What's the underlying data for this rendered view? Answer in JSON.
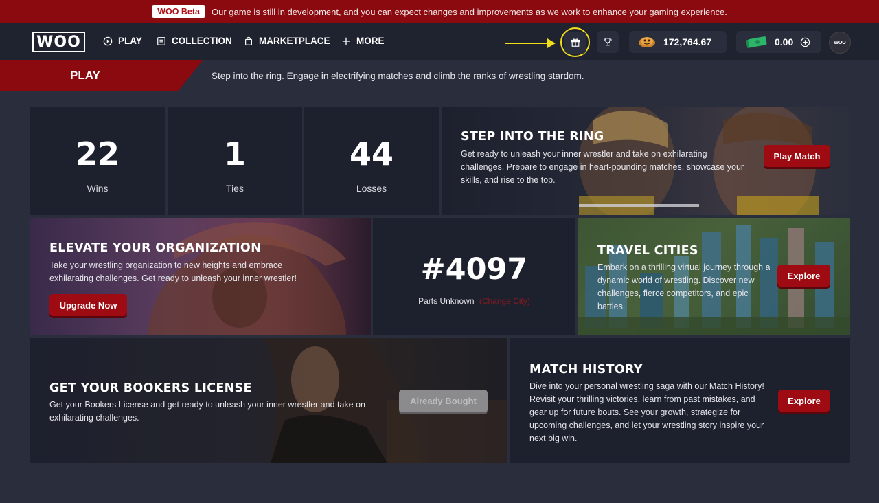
{
  "banner": {
    "badge": "WOO Beta",
    "message": "Our game is still in development, and you can expect changes and improvements as we work to enhance your gaming experience."
  },
  "nav": {
    "logo": "WOO",
    "items": [
      {
        "label": "PLAY",
        "icon": "play-circle-icon"
      },
      {
        "label": "COLLECTION",
        "icon": "collection-icon"
      },
      {
        "label": "MARKETPLACE",
        "icon": "shopping-bag-icon"
      },
      {
        "label": "MORE",
        "icon": "plus-icon"
      }
    ],
    "coins": "172,764.67",
    "cash": "0.00",
    "avatar_text": "WOO"
  },
  "page": {
    "tab": "PLAY",
    "description": "Step into the ring. Engage in electrifying matches and climb the ranks of wrestling stardom."
  },
  "stats": {
    "wins": {
      "value": "22",
      "label": "Wins"
    },
    "ties": {
      "value": "1",
      "label": "Ties"
    },
    "losses": {
      "value": "44",
      "label": "Losses"
    }
  },
  "step_ring": {
    "title": "STEP INTO THE RING",
    "text": "Get ready to unleash your inner wrestler and take on exhilarating challenges. Prepare to engage in heart-pounding matches, showcase your skills, and rise to the top.",
    "button": "Play Match"
  },
  "organization": {
    "title": "ELEVATE YOUR ORGANIZATION",
    "text": "Take your wrestling organization to new heights and embrace exhilarating challenges. Get ready to unleash your inner wrestler!",
    "button": "Upgrade Now"
  },
  "rank": {
    "number": "#4097",
    "city": "Parts Unknown",
    "change_link": "(Change City)"
  },
  "travel": {
    "title": "TRAVEL CITIES",
    "text": "Embark on a thrilling virtual journey through a dynamic world of wrestling. Discover new challenges, fierce competitors, and epic battles.",
    "button": "Explore"
  },
  "bookers": {
    "title": "GET YOUR BOOKERS LICENSE",
    "text": "Get your Bookers License and get ready to unleash your inner wrestler and take on exhilarating challenges.",
    "button": "Already Bought"
  },
  "history": {
    "title": "MATCH HISTORY",
    "text": "Dive into your personal wrestling saga with our Match History! Revisit your thrilling victories, learn from past mistakes, and gear up for future bouts. See your growth, strategize for upcoming challenges, and let your wrestling story inspire your next big win.",
    "button": "Explore"
  },
  "colors": {
    "brand_red": "#8a0a0f",
    "button_red": "#9e0b12",
    "highlight_yellow": "#f4de1c",
    "card_bg": "#1d202d",
    "page_bg": "#2a2d3c"
  }
}
